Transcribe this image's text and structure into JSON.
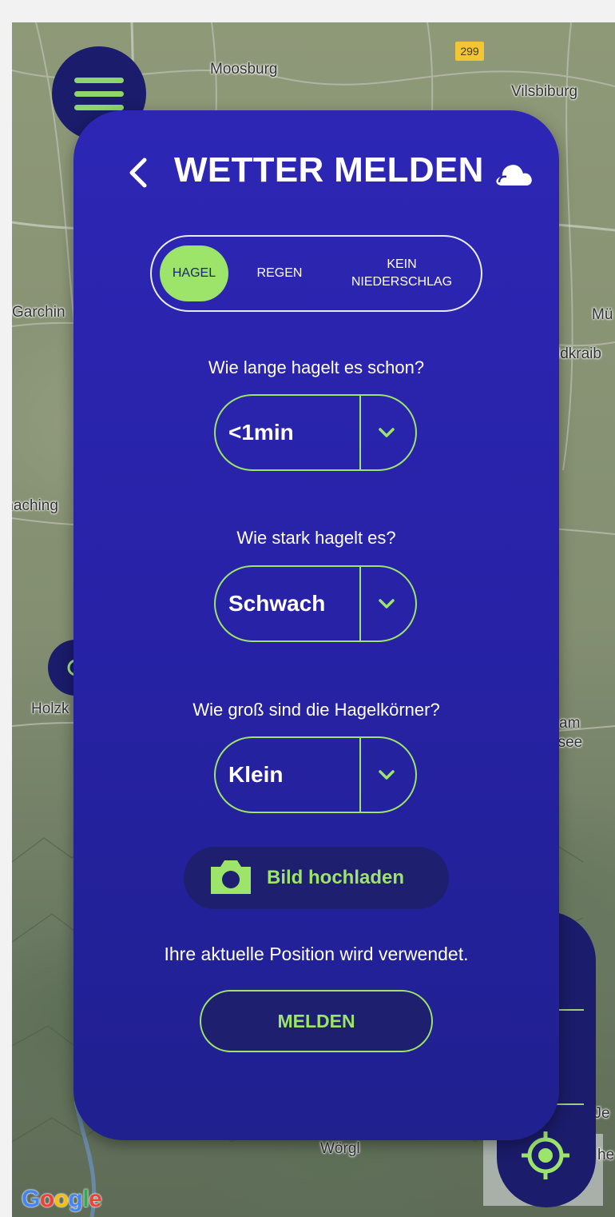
{
  "map": {
    "labels": {
      "moosburg": "Moosburg",
      "vilsbiburg": "Vilsbiburg",
      "garching": "Garchin",
      "muehldorf": "Mü",
      "waldkraiburg": "ldkraib",
      "unterhaching": "rhaching",
      "holzkirchen": "Holzk",
      "am": "am",
      "see": "nsee",
      "woergl": "Wörgl",
      "je": "t Je",
      "he": "he"
    },
    "road_number": "299",
    "attribution": [
      "G",
      "o",
      "o",
      "g",
      "l",
      "e"
    ]
  },
  "modal": {
    "title": "WETTER MELDEN",
    "tabs": [
      {
        "label": "HAGEL",
        "active": true
      },
      {
        "label": "REGEN",
        "active": false
      },
      {
        "label_line1": "KEIN",
        "label_line2": "NIEDERSCHLAG",
        "active": false
      }
    ],
    "questions": [
      {
        "text": "Wie lange hagelt es schon?",
        "value": "<1min"
      },
      {
        "text": "Wie stark hagelt es?",
        "value": "Schwach"
      },
      {
        "text": "Wie groß sind die Hagelkörner?",
        "value": "Klein"
      }
    ],
    "upload_label": "Bild hochladen",
    "position_note": "Ihre aktuelle Position wird verwendet.",
    "submit_label": "MELDEN"
  },
  "colors": {
    "accent": "#9ce46a",
    "modal_bg": "#2722a6",
    "dark_button": "#1b1c6b"
  },
  "icons": [
    "menu-icon",
    "back-icon",
    "cloud-icon",
    "chevron-down-icon",
    "camera-icon",
    "sun-icon",
    "locate-icon"
  ]
}
